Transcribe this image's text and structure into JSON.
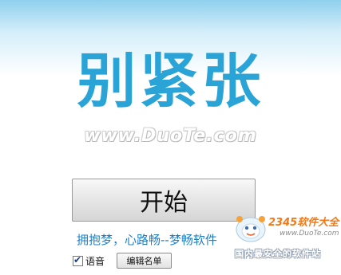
{
  "main": {
    "title": "别紧张",
    "watermark": "www.DuoTe.com",
    "start_label": "开始",
    "slogan": "拥抱梦，心路畅--梦畅软件"
  },
  "controls": {
    "voice_label": "语音",
    "voice_checked": true,
    "edit_list_label": "编辑名单"
  },
  "site_logo": {
    "brand": "2345软件大全",
    "url": "www.DuoTe.com",
    "tagline": "国内最安全的软件站"
  }
}
